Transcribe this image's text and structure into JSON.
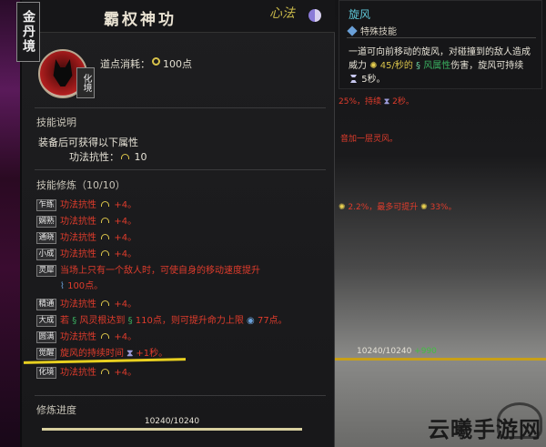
{
  "realm": {
    "label": "金丹境"
  },
  "skill": {
    "title": "霸权神功",
    "category_stamp": "心法",
    "badge": "化境",
    "cost_label": "道点消耗：",
    "cost_value": "100点"
  },
  "description": {
    "section_title": "技能说明",
    "line1": "装备后可获得以下属性",
    "attr_label": "功法抗性：",
    "attr_value": "10"
  },
  "cultivation": {
    "section_title": "技能修炼（10/10）",
    "rows": [
      {
        "tag": "乍练",
        "text": "功法抗性",
        "value": "+4。"
      },
      {
        "tag": "娴熟",
        "text": "功法抗性",
        "value": "+4。"
      },
      {
        "tag": "通晓",
        "text": "功法抗性",
        "value": "+4。"
      },
      {
        "tag": "小成",
        "text": "功法抗性",
        "value": "+4。"
      },
      {
        "tag": "灵犀",
        "text": "当场上只有一个敌人时，可使自身的移动速度提升",
        "text2": "100点。"
      },
      {
        "tag": "精通",
        "text": "功法抗性",
        "value": "+4。"
      },
      {
        "tag": "大成",
        "prefix": "若",
        "mid": "风灵根",
        "mid2": "达到",
        "mid3": "110点，则可提升命力上限",
        "end": "77点。"
      },
      {
        "tag": "圆满",
        "text": "功法抗性",
        "value": "+4。"
      },
      {
        "tag": "觉醒",
        "text": "旋风的持续时间",
        "value": "+1秒。"
      },
      {
        "tag": "化境",
        "text": "功法抗性",
        "value": "+4。"
      }
    ]
  },
  "progress": {
    "section_title": "修炼进度",
    "text": "10240/10240",
    "fraction": 1.0
  },
  "tooltip": {
    "title": "旋风",
    "tag": "特殊技能",
    "desc_line1": "一道可向前移动的旋风，对碰撞到的敌人造成",
    "desc_line2_a": "威力",
    "desc_line2_b": "45/秒的",
    "desc_line2_c": "风属性",
    "desc_line2_d": "伤害，旋风可持续",
    "desc_line3": "5秒。"
  },
  "background_text": {
    "line1": "25%，持续",
    "line1b": "2秒。",
    "line2": "音加一层灵风。",
    "line3": "2.2%，最多可提升",
    "line3b": "33%。"
  },
  "hp": {
    "text": "10240/10240",
    "gain": "+990"
  },
  "watermark": {
    "text": "云曦手游网"
  },
  "colors": {
    "accent_red": "#e03c2c",
    "accent_cyan": "#5fc7d8",
    "accent_yellow": "#d8c24a"
  }
}
